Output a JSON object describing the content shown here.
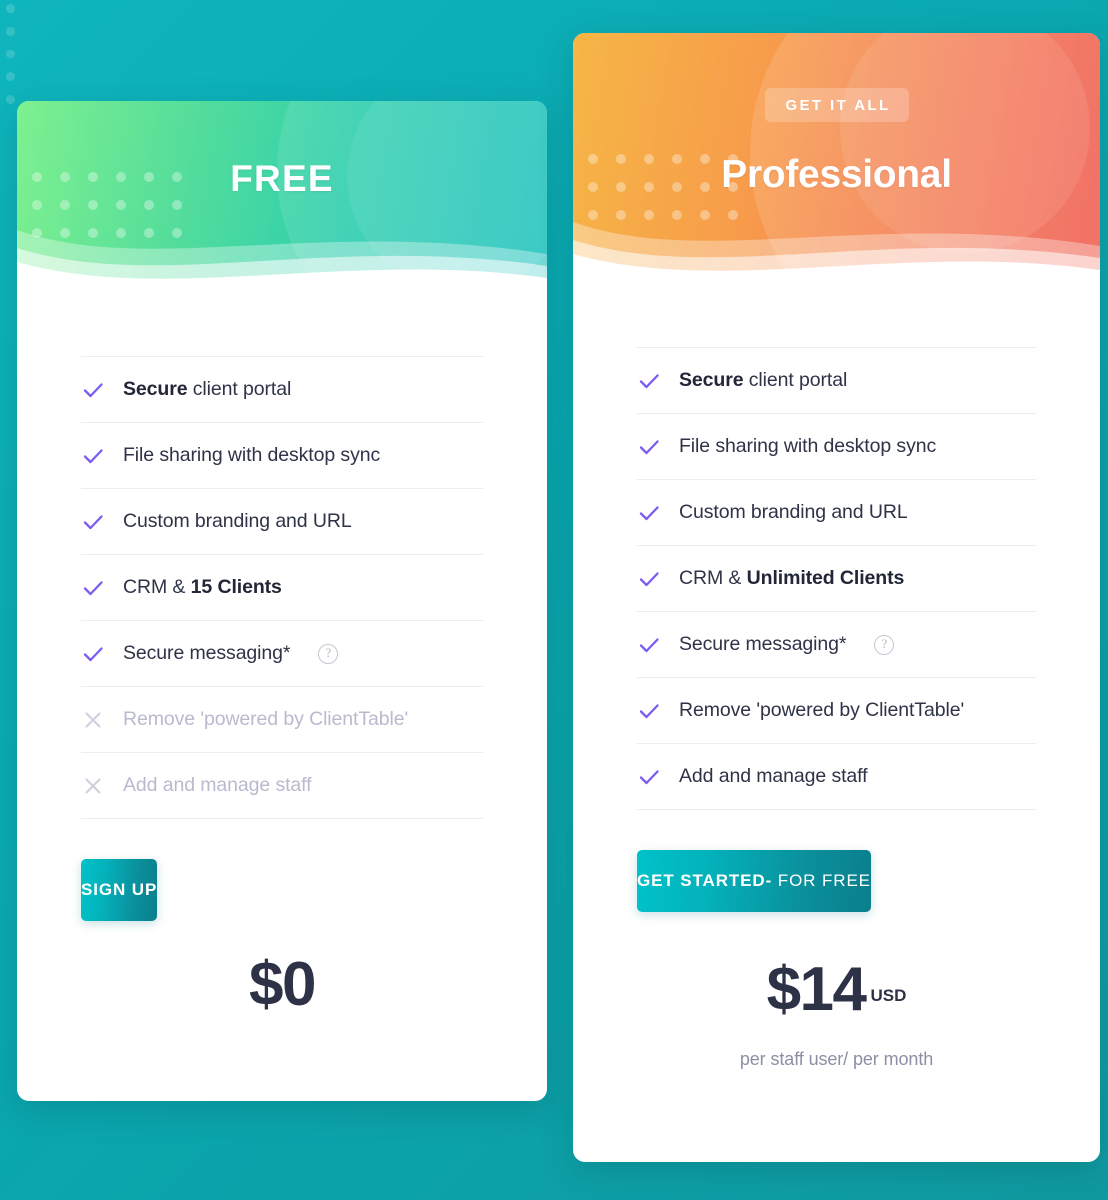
{
  "background": {
    "color_start": "#0fb5bd",
    "color_end": "#0f9aa0",
    "dots_count": 5
  },
  "plans": [
    {
      "id": "free",
      "badge": null,
      "title": "FREE",
      "header_gradient_start": "#7ef08f",
      "header_gradient_end": "#15bfbc",
      "features": [
        {
          "bold": "Secure",
          "text": " client portal",
          "included": true,
          "help": false
        },
        {
          "bold": "",
          "text": "File sharing with desktop sync",
          "included": true,
          "help": false
        },
        {
          "bold": "",
          "text": "Custom branding and URL",
          "included": true,
          "help": false
        },
        {
          "bold": "",
          "text": "CRM & ",
          "bold_after": "15 Clients",
          "included": true,
          "help": false
        },
        {
          "bold": "",
          "text": "Secure messaging*",
          "included": true,
          "help": true
        },
        {
          "bold": "",
          "text": "Remove 'powered by ClientTable'",
          "included": false,
          "help": false
        },
        {
          "bold": "",
          "text": "Add and manage staff",
          "included": false,
          "help": false
        }
      ],
      "cta_label": "SIGN UP",
      "cta_label_sub": "",
      "price": "$0",
      "price_currency": "",
      "price_note": ""
    },
    {
      "id": "professional",
      "badge": "GET IT ALL",
      "title": "Professional",
      "header_gradient_start": "#f6b645",
      "header_gradient_end": "#f05b50",
      "features": [
        {
          "bold": "Secure",
          "text": " client portal",
          "included": true,
          "help": false
        },
        {
          "bold": "",
          "text": "File sharing with desktop sync",
          "included": true,
          "help": false
        },
        {
          "bold": "",
          "text": "Custom branding and URL",
          "included": true,
          "help": false
        },
        {
          "bold": "",
          "text": "CRM & ",
          "bold_after": "Unlimited Clients",
          "included": true,
          "help": false
        },
        {
          "bold": "",
          "text": "Secure messaging*",
          "included": true,
          "help": true
        },
        {
          "bold": "",
          "text": "Remove 'powered by ClientTable'",
          "included": true,
          "help": false
        },
        {
          "bold": "",
          "text": "Add and manage staff",
          "included": true,
          "help": false
        }
      ],
      "cta_label": "GET STARTED-",
      "cta_label_sub": " FOR FREE",
      "price": "$14",
      "price_currency": "USD",
      "price_note": "per staff user/ per month"
    }
  ],
  "icons": {
    "check": "check-icon",
    "cross": "cross-icon",
    "help": "?"
  },
  "colors": {
    "check": "#7c5cf0",
    "cross": "#cfd0dc",
    "price_text": "#2e3247",
    "muted_text": "#b9bace",
    "cta_gradient_start": "#00c2c9",
    "cta_gradient_end": "#0b7f8c"
  }
}
